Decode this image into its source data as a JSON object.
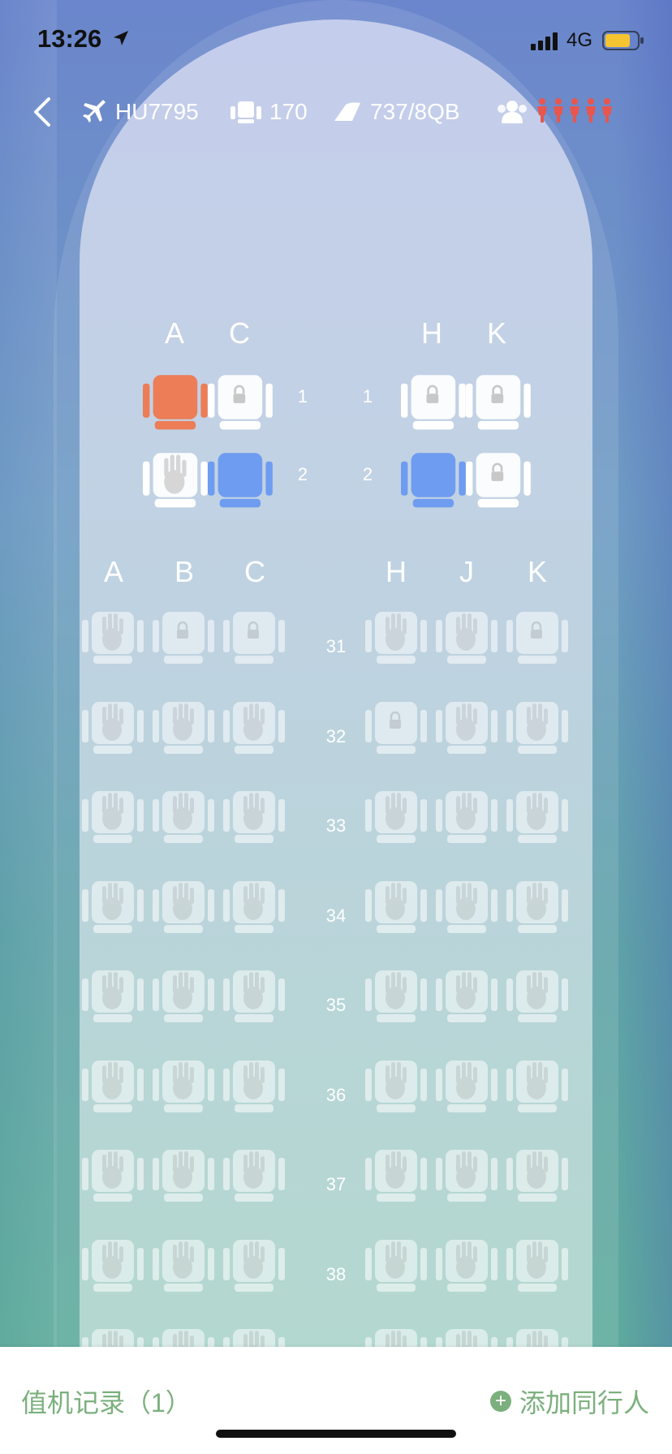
{
  "status_bar": {
    "time": "13:26",
    "network": "4G"
  },
  "flight": {
    "flight_number": "HU7795",
    "seat_count": "170",
    "aircraft": "737/8QB",
    "icons": [
      "plane-icon",
      "seats-icon",
      "aircraft-type-icon",
      "passengers-icon"
    ]
  },
  "first_class": {
    "left_cols": [
      "A",
      "C"
    ],
    "right_cols": [
      "H",
      "K"
    ],
    "rows": [
      {
        "num": "1",
        "seats": [
          "selected",
          "locked",
          "locked",
          "locked"
        ]
      },
      {
        "num": "2",
        "seats": [
          "occupied",
          "available",
          "available",
          "locked"
        ]
      }
    ]
  },
  "economy": {
    "left_cols": [
      "A",
      "B",
      "C"
    ],
    "right_cols": [
      "H",
      "J",
      "K"
    ],
    "rows": [
      {
        "num": "31",
        "seats": [
          "occupied",
          "locked",
          "locked",
          "occupied",
          "occupied",
          "locked"
        ]
      },
      {
        "num": "32",
        "seats": [
          "occupied",
          "occupied",
          "occupied",
          "locked",
          "occupied",
          "occupied"
        ]
      },
      {
        "num": "33",
        "seats": [
          "occupied",
          "occupied",
          "occupied",
          "occupied",
          "occupied",
          "occupied"
        ]
      },
      {
        "num": "34",
        "seats": [
          "occupied",
          "occupied",
          "occupied",
          "occupied",
          "occupied",
          "occupied"
        ]
      },
      {
        "num": "35",
        "seats": [
          "occupied",
          "occupied",
          "occupied",
          "occupied",
          "occupied",
          "occupied"
        ]
      },
      {
        "num": "36",
        "seats": [
          "occupied",
          "occupied",
          "occupied",
          "occupied",
          "occupied",
          "occupied"
        ]
      },
      {
        "num": "37",
        "seats": [
          "occupied",
          "occupied",
          "occupied",
          "occupied",
          "occupied",
          "occupied"
        ]
      },
      {
        "num": "38",
        "seats": [
          "occupied",
          "occupied",
          "occupied",
          "occupied",
          "occupied",
          "occupied"
        ]
      },
      {
        "num": "",
        "seats": [
          "occupied",
          "occupied",
          "occupied",
          "occupied",
          "occupied",
          "occupied"
        ]
      }
    ]
  },
  "bottom": {
    "checkin_record": "值机记录（1）",
    "add_companion": "添加同行人"
  },
  "colors": {
    "selected": "#ec7d56",
    "available": "#6e9cf0",
    "accent_green": "#7bb07d",
    "passenger_red": "#e8564e"
  }
}
